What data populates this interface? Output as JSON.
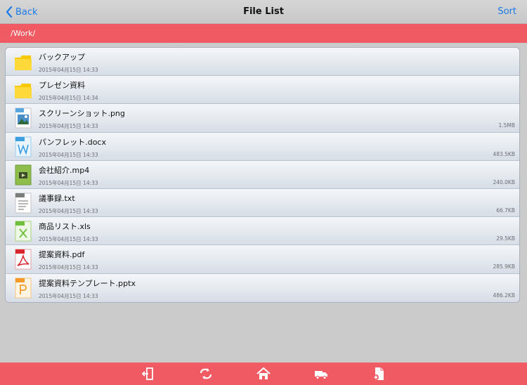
{
  "navbar": {
    "back_label": "Back",
    "title": "File List",
    "sort_label": "Sort"
  },
  "path": "/Work/",
  "colors": {
    "accent": "#ef5a63",
    "link": "#1a7ae8",
    "background": "#cbcbcb"
  },
  "files": [
    {
      "name": "バックアップ",
      "date": "2015年04月15日 14:33",
      "size": "",
      "icon": "folder-icon"
    },
    {
      "name": "プレゼン資料",
      "date": "2015年04月15日 14:34",
      "size": "",
      "icon": "folder-icon"
    },
    {
      "name": "スクリーンショット.png",
      "date": "2015年04月15日 14:33",
      "size": "1.5MB",
      "icon": "png-file-icon"
    },
    {
      "name": "パンフレット.docx",
      "date": "2015年04月15日 14:33",
      "size": "483.5KB",
      "icon": "doc-file-icon"
    },
    {
      "name": "会社紹介.mp4",
      "date": "2015年04月15日 14:33",
      "size": "240.0KB",
      "icon": "video-file-icon"
    },
    {
      "name": "議事録.txt",
      "date": "2015年04月15日 14:33",
      "size": "66.7KB",
      "icon": "txt-file-icon"
    },
    {
      "name": "商品リスト.xls",
      "date": "2015年04月15日 14:33",
      "size": "29.5KB",
      "icon": "xls-file-icon"
    },
    {
      "name": "提案資料.pdf",
      "date": "2015年04月15日 14:33",
      "size": "285.9KB",
      "icon": "pdf-file-icon"
    },
    {
      "name": "提案資料テンプレート.pptx",
      "date": "2015年04月15日 14:33",
      "size": "486.2KB",
      "icon": "ppt-file-icon"
    }
  ],
  "toolbar": {
    "items": [
      "exit-icon",
      "sync-icon",
      "home-icon",
      "truck-icon",
      "new-file-icon"
    ]
  }
}
